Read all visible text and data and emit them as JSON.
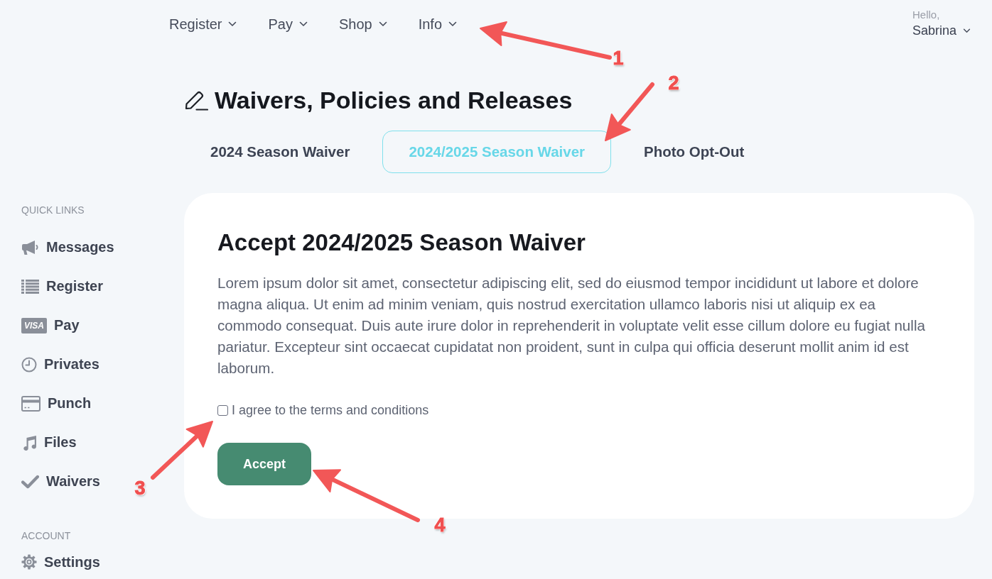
{
  "top_nav": {
    "items": [
      {
        "label": "Register"
      },
      {
        "label": "Pay"
      },
      {
        "label": "Shop"
      },
      {
        "label": "Info"
      }
    ],
    "user": {
      "greeting": "Hello,",
      "name": "Sabrina"
    }
  },
  "page_title": "Waivers, Policies and Releases",
  "tabs": [
    {
      "label": "2024 Season Waiver",
      "selected": false
    },
    {
      "label": "2024/2025 Season Waiver",
      "selected": true
    },
    {
      "label": "Photo Opt-Out",
      "selected": false
    }
  ],
  "sidebar": {
    "sections": [
      {
        "heading": "QUICK LINKS",
        "items": [
          {
            "label": "Messages"
          },
          {
            "label": "Register"
          },
          {
            "label": "Pay",
            "logo_text": "VISA"
          },
          {
            "label": "Privates"
          },
          {
            "label": "Punch"
          },
          {
            "label": "Files"
          },
          {
            "label": "Waivers"
          }
        ]
      },
      {
        "heading": "ACCOUNT",
        "items": [
          {
            "label": "Settings"
          }
        ]
      }
    ]
  },
  "card": {
    "title": "Accept 2024/2025 Season Waiver",
    "body": "Lorem ipsum dolor sit amet, consectetur adipiscing elit, sed do eiusmod tempor incididunt ut labore et dolore magna aliqua. Ut enim ad minim veniam, quis nostrud exercitation ullamco laboris nisi ut aliquip ex ea commodo consequat. Duis aute irure dolor in reprehenderit in voluptate velit esse cillum dolore eu fugiat nulla pariatur. Excepteur sint occaecat cupidatat non proident, sunt in culpa qui officia deserunt mollit anim id est laborum.",
    "agreement": {
      "label": "I agree to the terms and conditions",
      "checked": false
    },
    "button": "Accept"
  },
  "annotations": [
    {
      "label": "1"
    },
    {
      "label": "2"
    },
    {
      "label": "3"
    },
    {
      "label": "4"
    }
  ]
}
